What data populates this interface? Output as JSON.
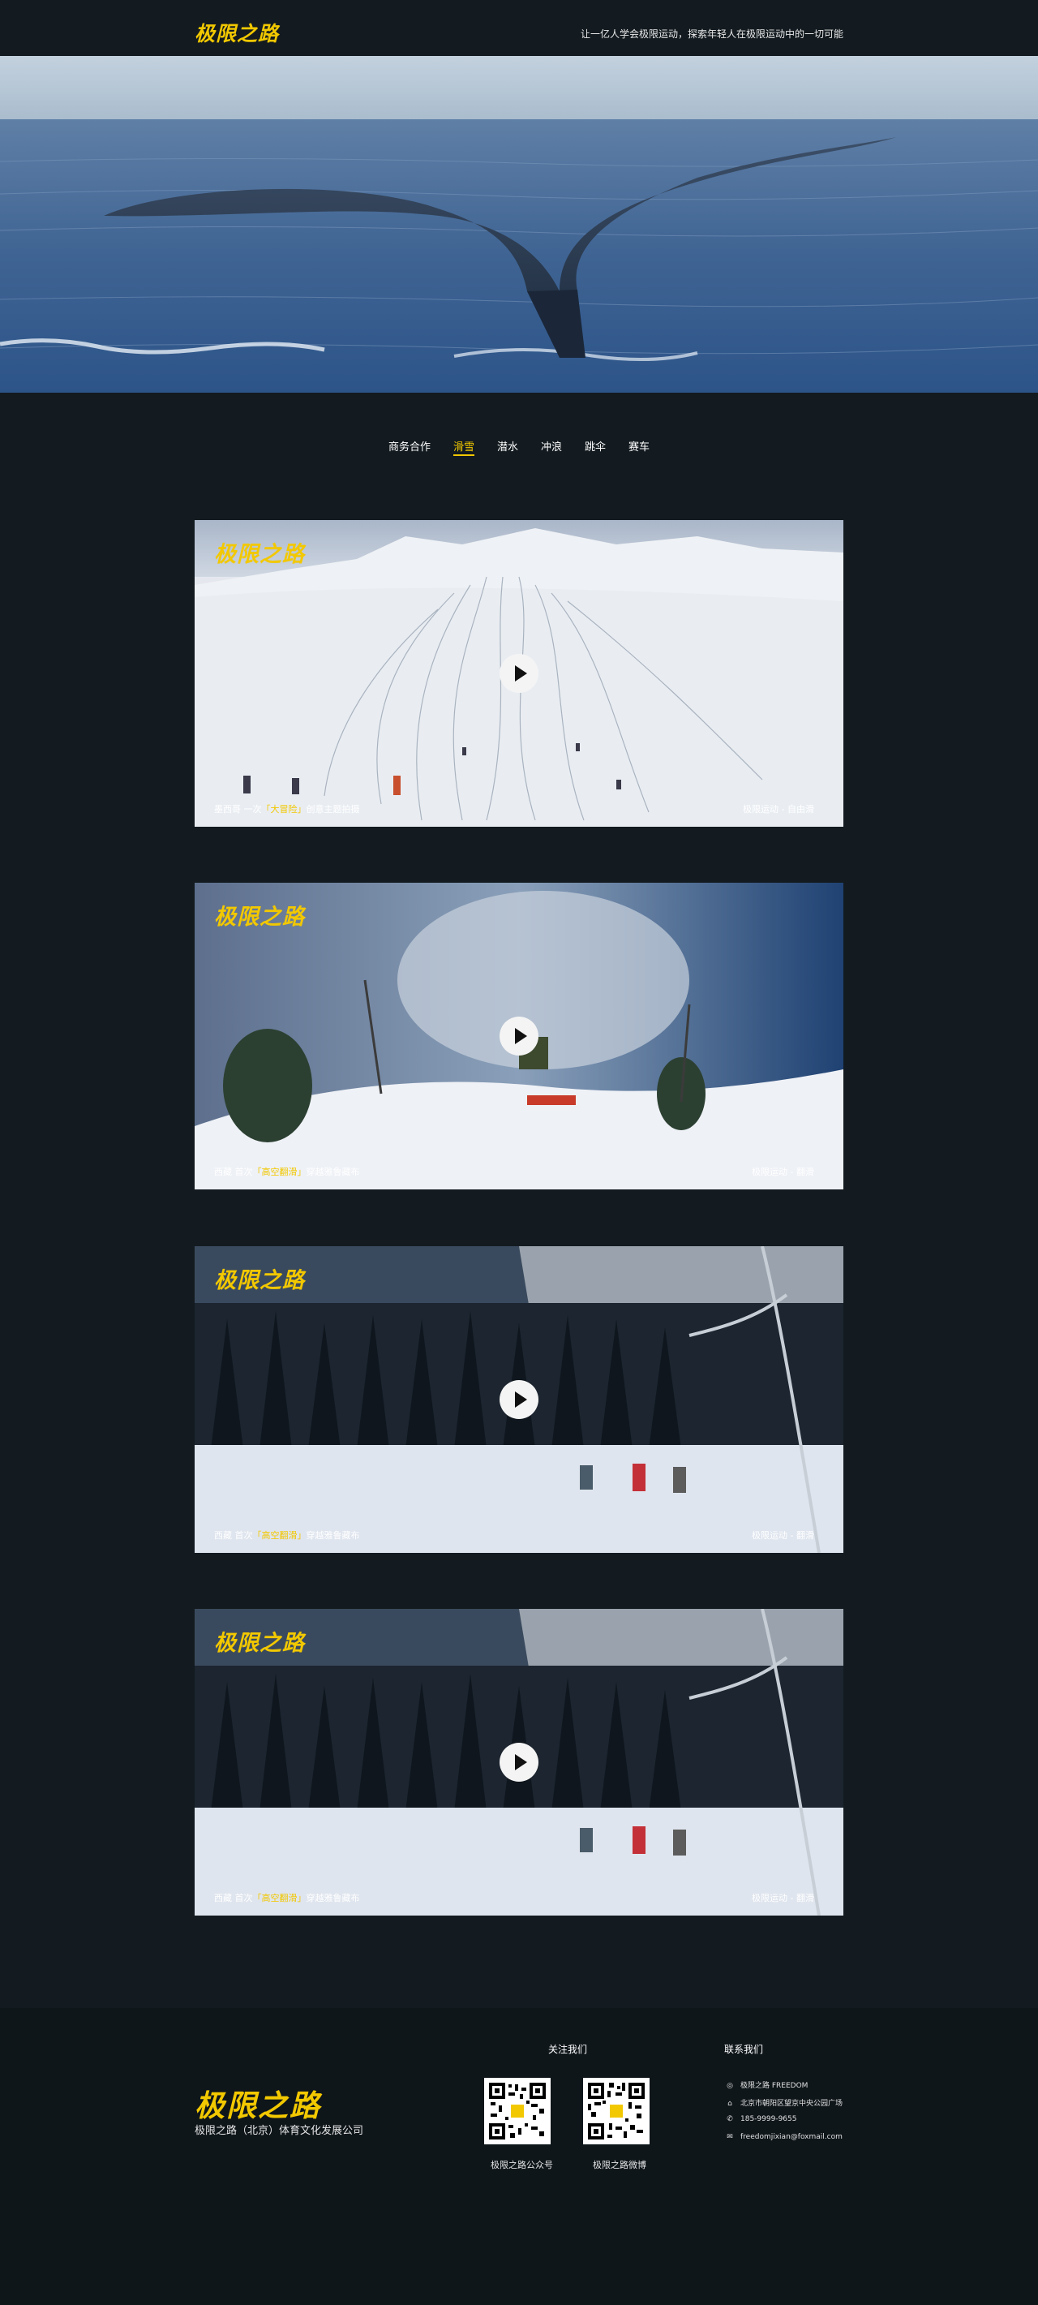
{
  "header": {
    "logo": "极限之路",
    "slogan": "让一亿人学会极限运动，探索年轻人在极限运动中的一切可能"
  },
  "nav": {
    "tabs": [
      "商务合作",
      "滑雪",
      "潜水",
      "冲浪",
      "跳伞",
      "赛车"
    ],
    "active": "滑雪"
  },
  "videos": [
    {
      "logo": "极限之路",
      "caption_pre": "墨西哥  一次",
      "caption_hl": "「大冒险」",
      "caption_post": "创意主题拍摄",
      "tag": "极限运动 - 自由滑"
    },
    {
      "logo": "极限之路",
      "caption_pre": "西藏      首次",
      "caption_hl": "「高空翻滑」",
      "caption_post": "穿越雅鲁藏布",
      "tag": "极限运动 - 翻滑"
    },
    {
      "logo": "极限之路",
      "caption_pre": "西藏      首次",
      "caption_hl": "「高空翻滑」",
      "caption_post": "穿越雅鲁藏布",
      "tag": "极限运动 - 翻滑"
    },
    {
      "logo": "极限之路",
      "caption_pre": "西藏      首次",
      "caption_hl": "「高空翻滑」",
      "caption_post": "穿越雅鲁藏布",
      "tag": "极限运动 - 翻滑"
    }
  ],
  "footer": {
    "logo": "极限之路",
    "company": "极限之路（北京）体育文化发展公司",
    "follow_title": "关注我们",
    "qr_labels": [
      "极限之路公众号",
      "极限之路微博"
    ],
    "contact_title": "联系我们",
    "contacts": [
      {
        "icon": "weibo-icon",
        "glyph": "◎",
        "text": "极限之路 FREEDOM"
      },
      {
        "icon": "home-icon",
        "glyph": "⌂",
        "text": "北京市朝阳区望京中央公园广场"
      },
      {
        "icon": "phone-icon",
        "glyph": "✆",
        "text": "185-9999-9655"
      },
      {
        "icon": "mail-icon",
        "glyph": "✉",
        "text": "freedomjixian@foxmail.com"
      }
    ]
  }
}
